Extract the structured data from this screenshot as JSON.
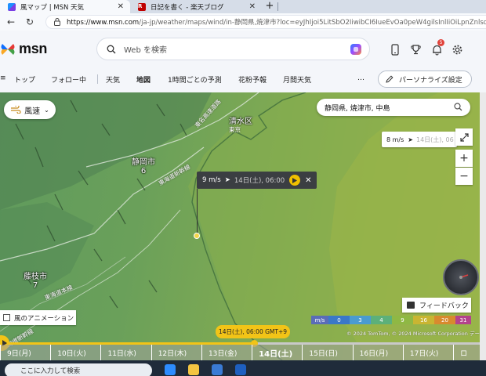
{
  "browser": {
    "tabs": [
      {
        "title": "風マップ | MSN 天気",
        "active": true
      },
      {
        "title": "日記を書く - 楽天ブログ",
        "active": false
      }
    ],
    "url_host": "https://www.msn.com",
    "url_path": "/ja-jp/weather/maps/wind/in-静岡県,焼津市?loc=eyJhIjoi5LitSbO2IiwibCI6IueEvOa0peW4gilsInlIiOiLpnZnlsqHnn"
  },
  "header": {
    "logo_text": "msn",
    "search_placeholder": "Web を検索",
    "notification_count": "5"
  },
  "nav": {
    "items": [
      "トップ",
      "フォロー中",
      "天気",
      "地図",
      "1時間ごとの予測",
      "花粉予報",
      "月間天気"
    ],
    "active": "地図",
    "more": "…",
    "personalize": "パーソナライズ設定"
  },
  "map": {
    "layer_label": "風速",
    "search_location": "静岡県, 焼津市, 中島",
    "readout_speed": "8 m/s",
    "readout_time": "14日(土), 06",
    "tooltip_speed": "9 m/s",
    "tooltip_time": "14日(土), 06:00",
    "city_labels": [
      {
        "name": "静岡市",
        "value": "6"
      },
      {
        "name": "藤枝市",
        "value": "7"
      },
      {
        "name": "清水区",
        "value": ""
      }
    ],
    "road_labels": [
      "東名高速道路",
      "東海道新幹線",
      "東海道本線",
      "東海道新幹線",
      "東京"
    ],
    "feedback": "フィードバック",
    "animation_label": "風のアニメーション",
    "copyright": "© 2024 TomTom, © 2024 Microsoft Corporation  データ提供元",
    "legend": {
      "unit": "m/s",
      "stops": [
        "0",
        "3",
        "4",
        "9",
        "16",
        "20",
        "31"
      ],
      "colors": [
        "#3a78c9",
        "#4a9bd0",
        "#5cb07a",
        "#8fb844",
        "#c9b532",
        "#d88a2e",
        "#b4438c"
      ]
    }
  },
  "timeline": {
    "current": "14日(土), 06:00 GMT+9",
    "progress": 0.52,
    "days": [
      "9日(月)",
      "10日(火)",
      "11日(水)",
      "12日(木)",
      "13日(金)",
      "14日(土)",
      "15日(日)",
      "16日(月)",
      "17日(火)",
      "ロ"
    ],
    "selected_day": "14日(土)"
  },
  "taskbar": {
    "search_placeholder": "ここに入力して検索"
  }
}
